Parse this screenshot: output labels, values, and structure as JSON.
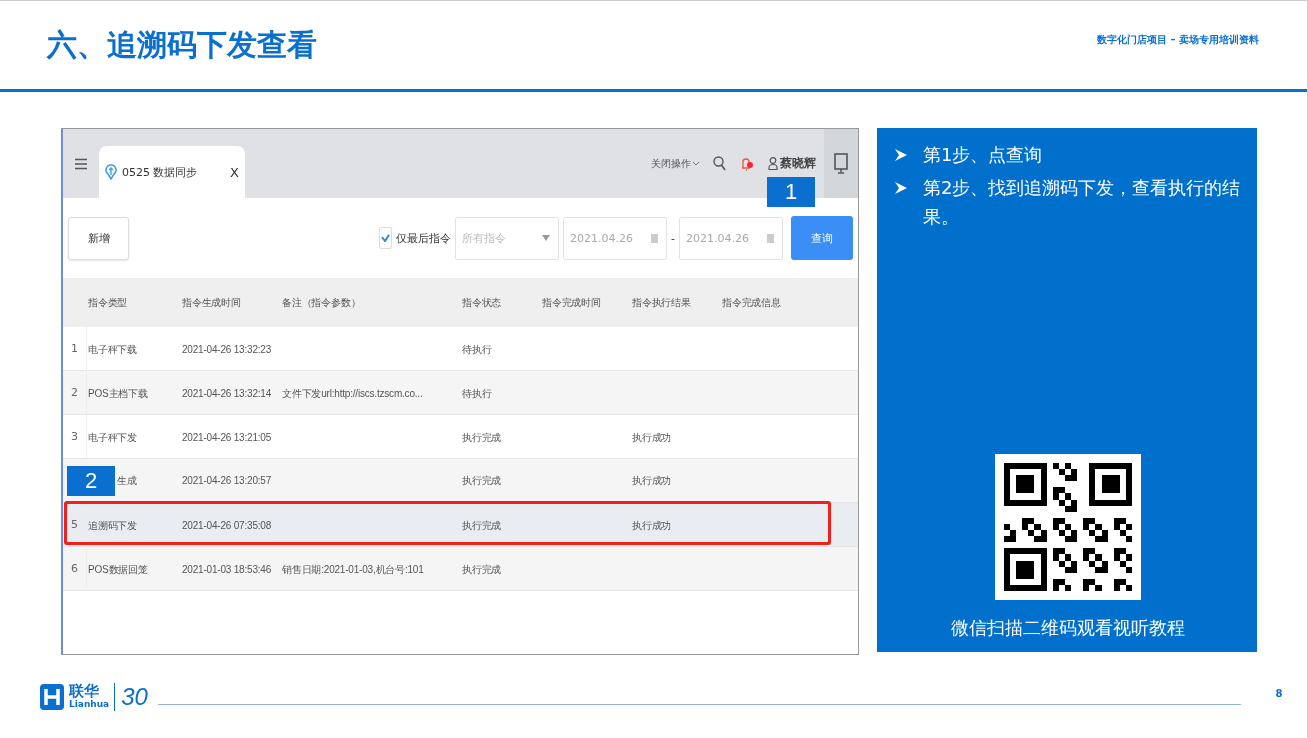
{
  "slide": {
    "title": "六、追溯码下发查看",
    "subtitle": "数字化门店项目 – 卖场专用培训资料",
    "page_number": "8"
  },
  "app": {
    "tab": {
      "label": "0525 数据同步",
      "close": "X",
      "selected": true
    },
    "header": {
      "menu_label": "关闭操作",
      "user": "蔡晓辉",
      "notification": true
    },
    "toolbar": {
      "add_button": "新增",
      "last_only": {
        "label": "仅最后指令",
        "checked": true
      },
      "type_select": {
        "placeholder": "所有指令"
      },
      "date_from": "2021.04.26",
      "date_separator": "-",
      "date_to": "2021.04.26",
      "query_button": "查询"
    },
    "table": {
      "columns": [
        "指令类型",
        "指令生成时间",
        "备注（指令参数）",
        "指令状态",
        "指令完成时间",
        "指令执行结果",
        "指令完成信息"
      ],
      "rows": [
        {
          "index": "1",
          "cells": [
            "电子秤下载",
            "2021-04-26 13:32:23",
            "",
            "待执行",
            "",
            "",
            ""
          ],
          "highlighted": false
        },
        {
          "index": "2",
          "cells": [
            "POS主档下载",
            "2021-04-26 13:32:14",
            "文件下发url:http://iscs.tzscm.co...",
            "待执行",
            "",
            "",
            ""
          ],
          "highlighted": false
        },
        {
          "index": "3",
          "cells": [
            "电子秤下发",
            "2021-04-26 13:21:05",
            "",
            "执行完成",
            "",
            "执行成功",
            ""
          ],
          "highlighted": false
        },
        {
          "callout": "2",
          "cells": [
            "生成",
            "2021-04-26 13:20:57",
            "",
            "执行完成",
            "",
            "执行成功",
            ""
          ],
          "highlighted": false
        },
        {
          "index": "5",
          "cells": [
            "追溯码下发",
            "2021-04-26 07:35:08",
            "",
            "执行完成",
            "",
            "执行成功",
            ""
          ],
          "highlighted": true
        },
        {
          "index": "6",
          "cells": [
            "POS数据回笼",
            "2021-01-03 18:53:46",
            "销售日期:2021-01-03,机台号:101",
            "执行完成",
            "",
            "",
            ""
          ],
          "highlighted": false
        }
      ]
    },
    "callout": "1"
  },
  "panel": {
    "steps": [
      "第1步、点查询",
      "第2步、找到追溯码下发，查看执行的结果。"
    ],
    "qr_caption": "微信扫描二维码观看视听教程"
  },
  "footer": {
    "logo_cn": "联华",
    "logo_en": "Lianhua",
    "logo_anniversary": "30"
  }
}
